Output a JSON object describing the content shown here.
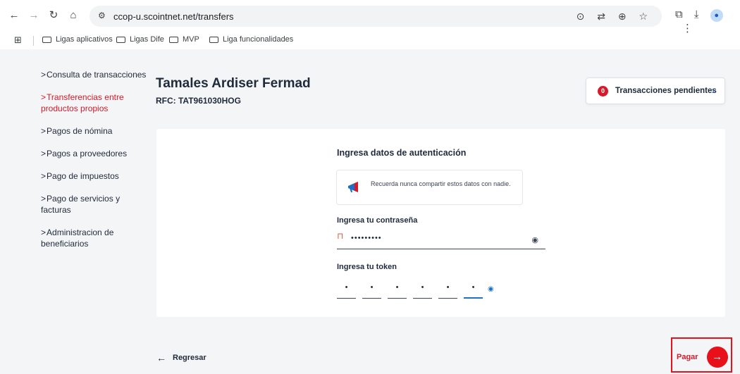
{
  "browser": {
    "url": "ccop-u.scointnet.net/transfers",
    "nav_icons": [
      "back-arrow-icon",
      "forward-arrow-icon",
      "reload-icon",
      "home-icon"
    ],
    "bookmarks": [
      "Ligas aplicativos",
      "Ligas Dife",
      "MVP",
      "Liga funcionalidades"
    ]
  },
  "sidebar": {
    "items": [
      {
        "label": "Consulta de transacciones",
        "active": false
      },
      {
        "label": "Transferencias entre productos propios",
        "active": true
      },
      {
        "label": "Pagos de nómina",
        "active": false
      },
      {
        "label": "Pagos a proveedores",
        "active": false
      },
      {
        "label": "Pago de impuestos",
        "active": false
      },
      {
        "label": "Pago de servicios y facturas",
        "active": false
      },
      {
        "label": "Administracion de beneficiarios",
        "active": false
      }
    ]
  },
  "header": {
    "client_name": "Tamales Ardiser Fermad",
    "rfc": "RFC: TAT961030HOG"
  },
  "pending": {
    "count": "0",
    "label": "Transacciones pendientes"
  },
  "auth": {
    "title": "Ingresa datos de autenticación",
    "notice": "Recuerda nunca compartir estos datos con nadie.",
    "password_label": "Ingresa tu contraseña",
    "password_value": "•••••••••",
    "token_label": "Ingresa tu token",
    "token_digits": [
      "•",
      "•",
      "•",
      "•",
      "•",
      "•"
    ]
  },
  "footer": {
    "back_label": "Regresar",
    "pay_label": "Pagar"
  },
  "colors": {
    "brand_red": "#e8101a",
    "accent_blue": "#1a73c9",
    "text_dark": "#1f2a3a"
  }
}
